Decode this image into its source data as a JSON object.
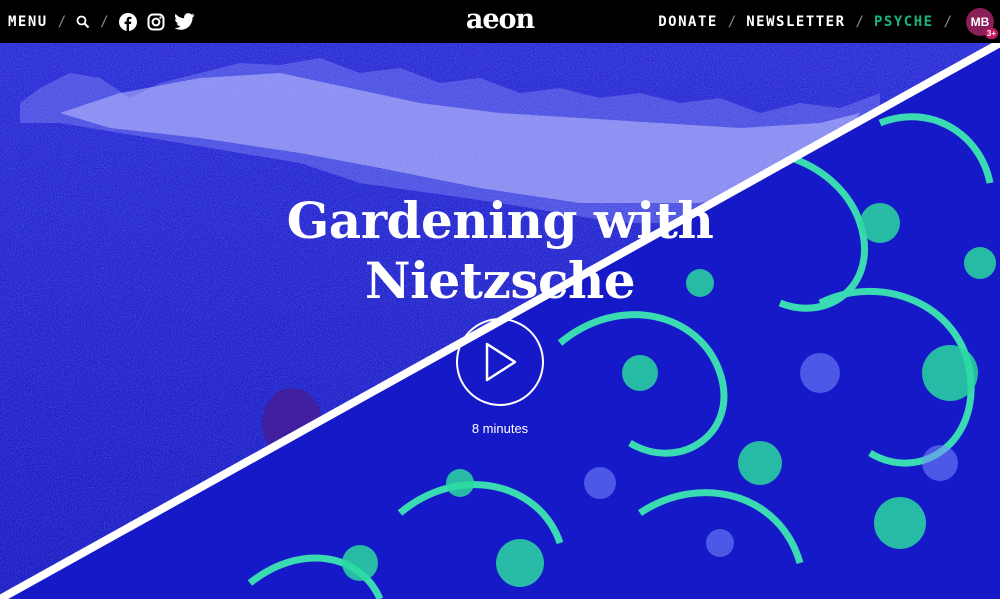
{
  "header": {
    "menu_label": "MENU",
    "separator": "/",
    "logo": "aeon",
    "donate_label": "DONATE",
    "newsletter_label": "NEWSLETTER",
    "psyche_label": "PSYCHE",
    "avatar_initials": "MB",
    "avatar_badge": "3+",
    "icons": [
      "search-icon",
      "facebook-icon",
      "instagram-icon",
      "twitter-icon"
    ]
  },
  "hero": {
    "title_line1": "Gardening with",
    "title_line2": "Nietzsche",
    "duration": "8 minutes"
  },
  "colors": {
    "background": "#1c1fcf",
    "accent_green": "#1bb37a",
    "pattern_mint": "#3ef0b0",
    "avatar": "#8a1f58"
  }
}
